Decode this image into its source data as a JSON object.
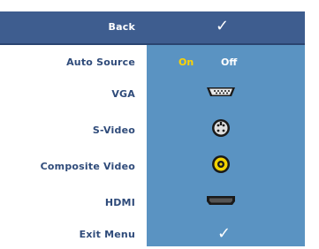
{
  "menu": {
    "back_label": "Back",
    "items": [
      {
        "label": "Auto Source",
        "on": "On",
        "off": "Off"
      },
      {
        "label": "VGA",
        "icon": "vga-connector-icon"
      },
      {
        "label": "S-Video",
        "icon": "s-video-connector-icon"
      },
      {
        "label": "Composite Video",
        "icon": "composite-video-connector-icon"
      },
      {
        "label": "HDMI",
        "icon": "hdmi-connector-icon"
      },
      {
        "label": "Exit Menu",
        "icon": "checkmark-icon"
      }
    ],
    "checkmark": "✓"
  },
  "colors": {
    "header_bg": "#3e5d8f",
    "panel_bg": "#5a93c2",
    "label_text": "#2f4b7a",
    "on_text": "#ffd400",
    "off_text": "#ffffff"
  }
}
